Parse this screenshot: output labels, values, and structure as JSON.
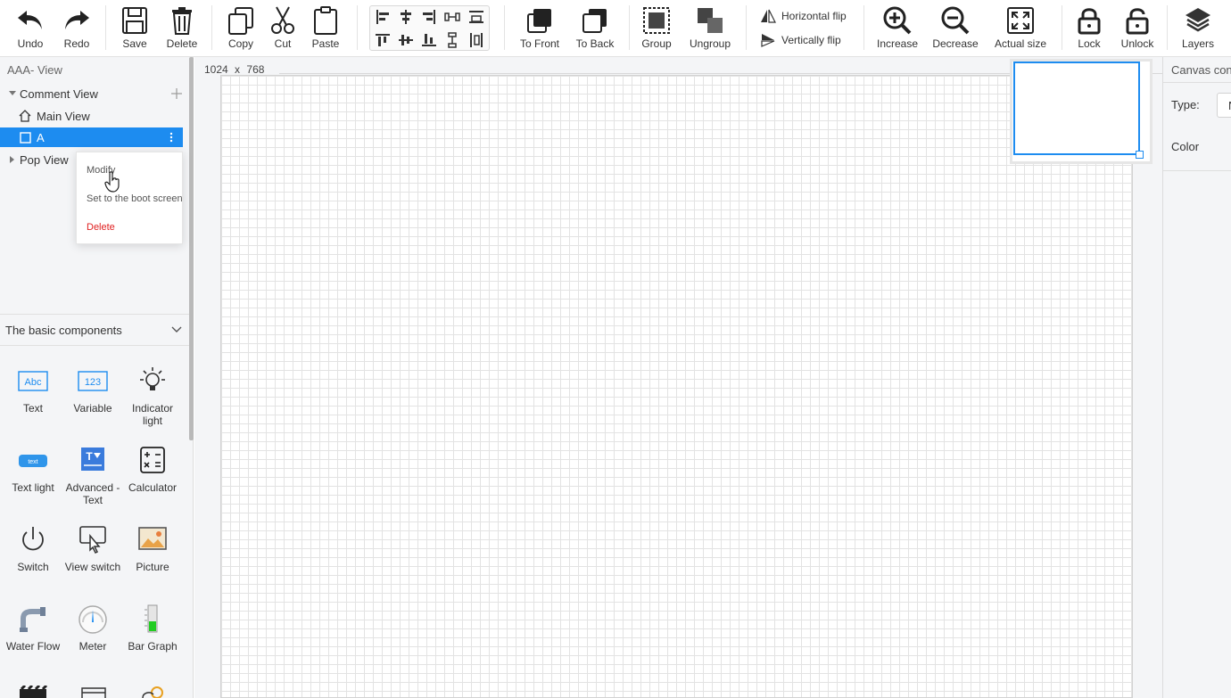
{
  "toolbar": {
    "undo": "Undo",
    "redo": "Redo",
    "save": "Save",
    "delete": "Delete",
    "copy": "Copy",
    "cut": "Cut",
    "paste": "Paste",
    "to_front": "To Front",
    "to_back": "To Back",
    "group": "Group",
    "ungroup": "Ungroup",
    "horizontal_flip": "Horizontal flip",
    "vertical_flip": "Vertically flip",
    "increase": "Increase",
    "decrease": "Decrease",
    "actual_size": "Actual size",
    "lock": "Lock",
    "unlock": "Unlock",
    "layers": "Layers"
  },
  "left_panel": {
    "title": "AAA- View",
    "tree": {
      "comment_view": "Comment View",
      "main_view": "Main View",
      "selected_item": "A",
      "pop_view": "Pop View"
    },
    "context_menu": {
      "modify": "Modify",
      "set_boot": "Set to the boot screen",
      "delete": "Delete"
    },
    "components_header": "The basic components",
    "components": [
      {
        "label": "Text",
        "icon": "text-icon",
        "glyph": "Abc"
      },
      {
        "label": "Variable",
        "icon": "variable-icon",
        "glyph": "123"
      },
      {
        "label": "Indicator light",
        "icon": "bulb-icon"
      },
      {
        "label": "Text light",
        "icon": "text-light-icon",
        "glyph": "text"
      },
      {
        "label": "Advanced - Text",
        "icon": "advanced-text-icon",
        "glyph": "T"
      },
      {
        "label": "Calculator",
        "icon": "calculator-icon"
      },
      {
        "label": "Switch",
        "icon": "power-icon"
      },
      {
        "label": "View switch",
        "icon": "view-switch-icon"
      },
      {
        "label": "Picture",
        "icon": "picture-icon"
      },
      {
        "label": "Water Flow",
        "icon": "water-flow-icon"
      },
      {
        "label": "Meter",
        "icon": "meter-icon"
      },
      {
        "label": "Bar Graph",
        "icon": "bar-graph-icon"
      }
    ]
  },
  "canvas": {
    "width": "1024",
    "separator": "x",
    "height": "768"
  },
  "right_panel": {
    "title": "Canvas con",
    "type_label": "Type:",
    "type_value": "N",
    "color_label": "Color"
  },
  "colors": {
    "accent": "#1d8cf0",
    "danger": "#e02020",
    "panel_bg": "#f4f5f7"
  }
}
